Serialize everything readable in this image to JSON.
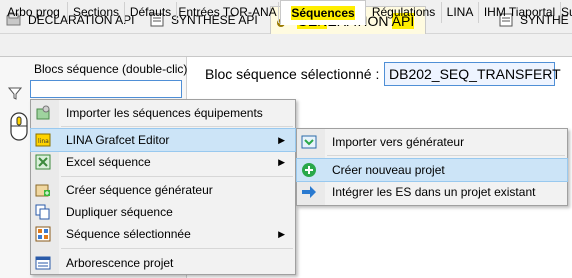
{
  "top_tabs": [
    {
      "label": "DECLARATION API",
      "icon": "declaration-icon"
    },
    {
      "label": "SYNTHESE API",
      "icon": "synthese-icon"
    },
    {
      "label_parts": [
        "GEN",
        "ERATION ",
        "API"
      ],
      "icon": "gear-icon"
    },
    {
      "label": "SYNTHE",
      "icon": "synthese-icon"
    }
  ],
  "sec_tabs": [
    "Arbo prog",
    "Sections",
    "Défauts",
    "Entrées TOR-ANA",
    "Séquences",
    "Régulations",
    "LINA",
    "IHM Tiaportal",
    "Su"
  ],
  "left": {
    "list_label": "Blocs séquence (double-clic)"
  },
  "main": {
    "selected_label": "Bloc séquence sélectionné :",
    "selected_value": "DB202_SEQ_TRANSFERT"
  },
  "context_menu": {
    "items": [
      {
        "label": "Importer les séquences équipements",
        "icon": "import-icon"
      },
      {
        "label": "LINA Grafcet Editor",
        "icon": "lina-icon",
        "submenu": true,
        "selected": true
      },
      {
        "label": "Excel séquence",
        "icon": "excel-icon",
        "submenu": true
      },
      {
        "label": "Créer séquence générateur",
        "icon": "create-sequence-icon"
      },
      {
        "label": "Dupliquer séquence",
        "icon": "duplicate-icon"
      },
      {
        "label": "Séquence sélectionnée",
        "icon": "sequence-icon",
        "submenu": true
      },
      {
        "label": "Arborescence projet",
        "icon": "tree-icon"
      }
    ]
  },
  "submenu": {
    "items": [
      {
        "label": "Importer vers générateur",
        "icon": "import-generator-icon"
      },
      {
        "label": "Créer nouveau projet",
        "icon": "add-circle-icon",
        "selected": true
      },
      {
        "label": "Intégrer les ES dans un projet existant",
        "icon": "arrow-right-icon"
      }
    ]
  },
  "colors": {
    "accent": "#4f8fd6",
    "highlight": "#ffee00",
    "menu_selected": "#cce4f7"
  }
}
